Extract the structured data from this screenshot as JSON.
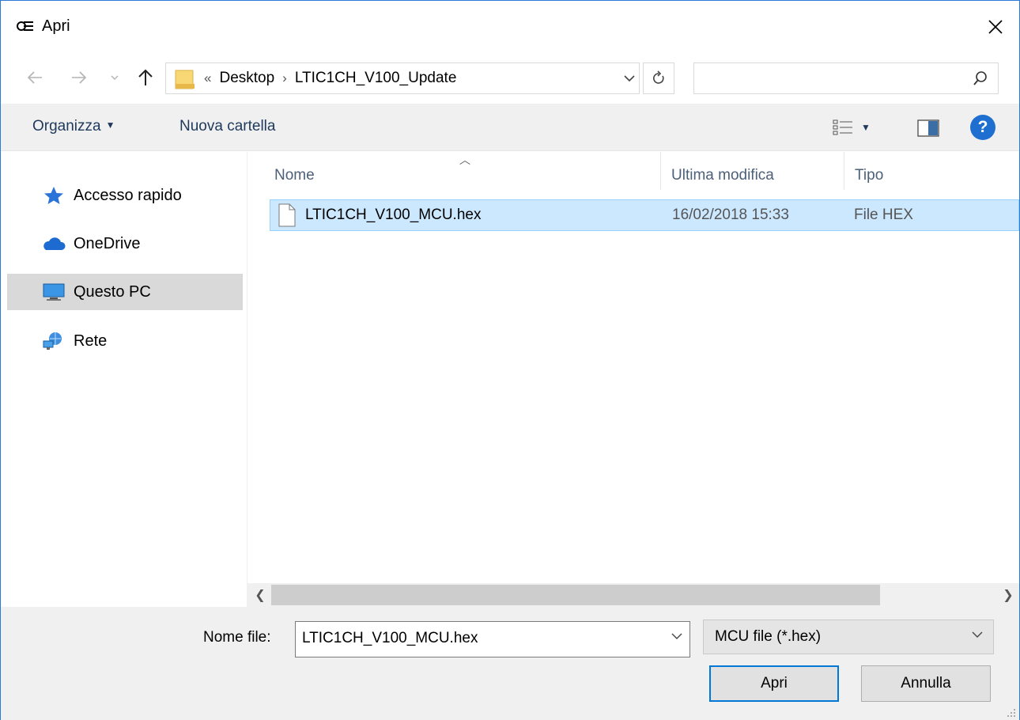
{
  "window": {
    "title": "Apri"
  },
  "address": {
    "overflow": "«",
    "crumbs": [
      "Desktop",
      "LTIC1CH_V100_Update"
    ],
    "search_placeholder": ""
  },
  "toolbar": {
    "organize_label": "Organizza",
    "new_folder_label": "Nuova cartella",
    "help_label": "?"
  },
  "nav_pane": {
    "items": [
      {
        "label": "Accesso rapido",
        "icon": "star-icon"
      },
      {
        "label": "OneDrive",
        "icon": "cloud-icon"
      },
      {
        "label": "Questo PC",
        "icon": "computer-icon",
        "selected": true
      },
      {
        "label": "Rete",
        "icon": "network-icon"
      }
    ]
  },
  "file_list": {
    "columns": [
      "Nome",
      "Ultima modifica",
      "Tipo"
    ],
    "rows": [
      {
        "name": "LTIC1CH_V100_MCU.hex",
        "modified": "16/02/2018 15:33",
        "type": "File HEX",
        "selected": true
      }
    ]
  },
  "bottom": {
    "filename_label": "Nome file:",
    "filename_value": "LTIC1CH_V100_MCU.hex",
    "filter_value": "MCU file (*.hex)",
    "open_label": "Apri",
    "cancel_label": "Annulla"
  },
  "colors": {
    "accent": "#0078d7",
    "selection": "#cce8ff",
    "nav_selected": "#d9d9d9",
    "toolbar_bg": "#f0f0f0"
  }
}
